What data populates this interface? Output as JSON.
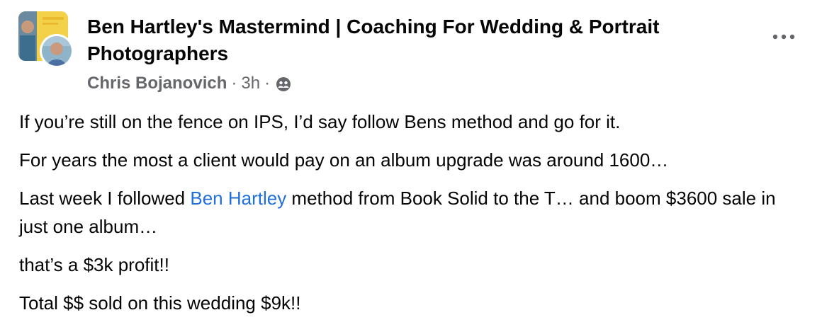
{
  "post": {
    "group_name": "Ben Hartley's Mastermind | Coaching For Wedding & Portrait Photographers",
    "author": "Chris Bojanovich",
    "separator": "·",
    "timestamp": "3h",
    "audience_icon": "group-audience-icon",
    "more_icon": "more-options-icon",
    "paragraphs": {
      "p1": "If you’re still on the fence on IPS, I’d say follow Bens method and go for it.",
      "p2": "For years the most a client would pay on an album upgrade was around 1600…",
      "p3_before": "Last week I followed ",
      "p3_link": "Ben Hartley",
      "p3_after": " method  from Book Solid to the T… and boom $3600 sale in just one album…",
      "p4": "that’s a $3k profit!!",
      "p5": "Total $$ sold on this wedding $9k!!"
    }
  },
  "colors": {
    "text_primary": "#050505",
    "text_secondary": "#65676b",
    "link": "#216fdb"
  }
}
